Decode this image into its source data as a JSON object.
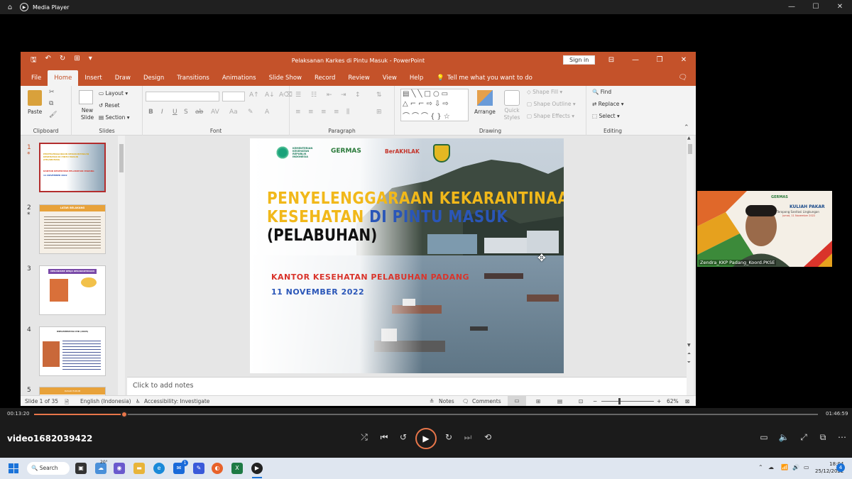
{
  "player": {
    "title": "Media Player",
    "current_time": "00:13:20",
    "total_time": "01:46:59",
    "progress": 0.115,
    "video_name": "video1682039422"
  },
  "ppt": {
    "title": "Pelaksanan Karkes di Pintu Masuk  -  PowerPoint",
    "sign_in": "Sign in",
    "tabs": [
      "File",
      "Home",
      "Insert",
      "Draw",
      "Design",
      "Transitions",
      "Animations",
      "Slide Show",
      "Record",
      "Review",
      "View",
      "Help"
    ],
    "tell_me": "Tell me what you want to do",
    "ribbon": {
      "clipboard": {
        "label": "Clipboard",
        "paste": "Paste"
      },
      "slides": {
        "label": "Slides",
        "new_slide": "New Slide",
        "layout": "Layout",
        "reset": "Reset",
        "section": "Section"
      },
      "font": {
        "label": "Font",
        "bold": "B",
        "italic": "I",
        "underline": "U",
        "strike": "S",
        "shadow": "ab"
      },
      "paragraph": {
        "label": "Paragraph"
      },
      "drawing": {
        "label": "Drawing",
        "arrange": "Arrange",
        "quick_styles": "Quick Styles",
        "shape_fill": "Shape Fill",
        "shape_outline": "Shape Outline",
        "shape_effects": "Shape Effects"
      },
      "editing": {
        "label": "Editing",
        "find": "Find",
        "replace": "Replace",
        "select": "Select"
      }
    },
    "thumbnails": [
      {
        "num": "1",
        "star": "*",
        "title": "PENYELENGGARAAN KEKARANTINAAN KESEHATAN DI PINTU MASUK (PELABUHAN)",
        "subtitle": "KANTOR KESEHATAN PELABUHAN PADANG",
        "date": "11 NOVEMBER 2022"
      },
      {
        "num": "2",
        "star": "*",
        "title": "LATAR BELAKANG"
      },
      {
        "num": "3",
        "star": "",
        "title": "MEKANISME KERJA KEKARANTINAAN"
      },
      {
        "num": "4",
        "star": "",
        "title": "IMPLEMENTASI IHR (2005)"
      },
      {
        "num": "5",
        "star": "",
        "title": "DASAR HUKUM"
      }
    ],
    "slide": {
      "logos": [
        "KEMENTERIAN KESEHATAN REPUBLIK INDONESIA",
        "GERMAS",
        "BerAKHLAK"
      ],
      "title_line1": "PENYELENGGARAAN KEKARANTINAAN",
      "title_line2a": "KESEHATAN",
      "title_line2b": " DI PINTU MASUK",
      "title_line3": "(PELABUHAN)",
      "office": "KANTOR KESEHATAN PELABUHAN PADANG",
      "date": "11 NOVEMBER 2022"
    },
    "notes_placeholder": "Click to add notes",
    "status": {
      "slide": "Slide 1 of 35",
      "language": "English (Indonesia)",
      "accessibility": "Accessibility: Investigate",
      "notes": "Notes",
      "comments": "Comments",
      "zoom": "62%"
    }
  },
  "webcam": {
    "banner_title": "KULIAH PAKAR",
    "banner_sub": "Teropong Sanitasi Lingkungan",
    "banner_date": "Jumat, 11 November 2022",
    "logo": "GERMAS",
    "participant": "Zendra_KKP Padang_Koord.PKSE"
  },
  "taskbar": {
    "search": "Search",
    "weather": "20°",
    "badge": "1",
    "time": "18:04",
    "date": "25/12/2022",
    "notif": "4"
  },
  "colors": {
    "ppt_accent": "#c4522a",
    "player_accent": "#e8764a",
    "title_yellow": "#f1b81a",
    "title_blue": "#2a56b8",
    "office_red": "#d9342b"
  }
}
